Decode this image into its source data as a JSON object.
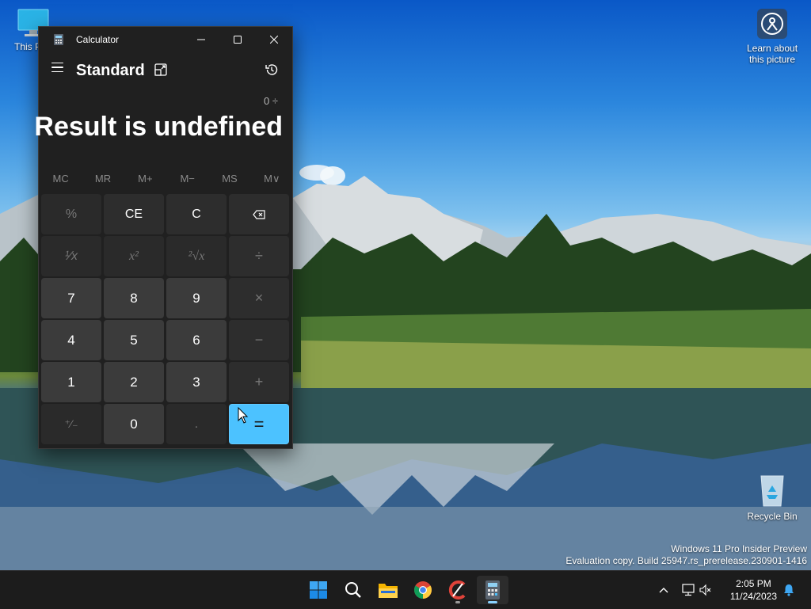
{
  "desktop": {
    "icons": [
      {
        "label": "This PC",
        "visible_label": "This P"
      },
      {
        "label": "Learn about this picture",
        "line1": "Learn about",
        "line2": "this picture"
      },
      {
        "label": "Recycle Bin"
      }
    ],
    "watermark": {
      "line1": "Windows 11 Pro Insider Preview",
      "line2": "Evaluation copy. Build 25947.rs_prerelease.230901-1416"
    }
  },
  "calculator": {
    "window_title": "Calculator",
    "mode": "Standard",
    "expression": "0 ÷",
    "result": "Result is undefined",
    "memory_buttons": [
      "MC",
      "MR",
      "M+",
      "M−",
      "MS",
      "M∨"
    ],
    "keys": {
      "percent": "%",
      "clear_entry": "CE",
      "clear": "C",
      "backspace": "⌫",
      "reciprocal": "¹⁄x",
      "square": "x²",
      "sqrt": "²√x",
      "divide": "÷",
      "seven": "7",
      "eight": "8",
      "nine": "9",
      "multiply": "×",
      "four": "4",
      "five": "5",
      "six": "6",
      "minus": "−",
      "one": "1",
      "two": "2",
      "three": "3",
      "plus": "+",
      "negate": "⁺⁄₋",
      "zero": "0",
      "decimal": ".",
      "equals": "="
    }
  },
  "taskbar": {
    "apps": [
      "start",
      "search",
      "file-explorer",
      "chrome",
      "ccleaner",
      "calculator"
    ],
    "clock": {
      "time": "2:05 PM",
      "date": "11/24/2023"
    }
  },
  "colors": {
    "accent": "#4cc2ff",
    "window_bg": "#202020",
    "number_key": "#3b3b3b",
    "function_key": "#2d2d2d",
    "taskbar": "#1c1c1c"
  }
}
